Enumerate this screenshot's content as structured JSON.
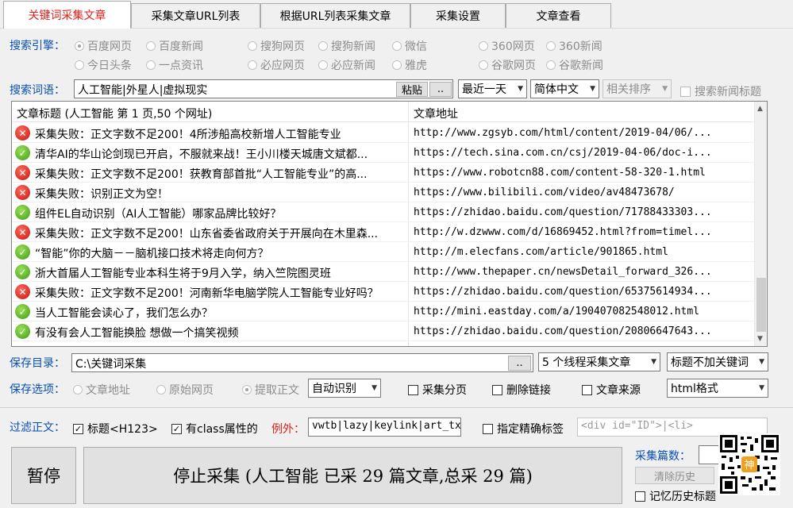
{
  "tabs": [
    "关键词采集文章",
    "采集文章URL列表",
    "根据URL列表采集文章",
    "采集设置",
    "文章查看"
  ],
  "engine": {
    "label": "搜索引擎：",
    "options": [
      "百度网页",
      "百度新闻",
      "搜狗网页",
      "搜狗新闻",
      "微信",
      "360网页",
      "360新闻",
      "今日头条",
      "一点资讯",
      "必应网页",
      "必应新闻",
      "雅虎",
      "谷歌网页",
      "谷歌新闻"
    ]
  },
  "keywords": {
    "label": "搜索词语：",
    "value": "人工智能|外星人|虚拟现实",
    "paste_label": "粘贴",
    "more_label": "..",
    "time_select": "最近一天",
    "lang_select": "简体中文",
    "sort_select": "相关排序",
    "news_title_label": "搜索新闻标题"
  },
  "table": {
    "col_title": "文章标题 (人工智能 第 1 页,50 个网址)",
    "col_url": "文章地址",
    "rows": [
      {
        "status": "fail",
        "title": "采集失败：正文字数不足200！4所涉船高校新增人工智能专业",
        "url": "http://www.zgsyb.com/html/content/2019-04/06/..."
      },
      {
        "status": "ok",
        "title": "清华AI的华山论剑现已开启，不服就来战！王小川楼天城唐文斌都...",
        "url": "https://tech.sina.com.cn/csj/2019-04-06/doc-i..."
      },
      {
        "status": "fail",
        "title": "采集失败：正文字数不足200！获教育部首批“人工智能专业”的高...",
        "url": "https://www.robotcn88.com/content-58-320-1.html"
      },
      {
        "status": "fail",
        "title": "采集失败：识别正文为空！",
        "url": "https://www.bilibili.com/video/av48473678/"
      },
      {
        "status": "ok",
        "title": "组件EL自动识别（AI人工智能）哪家品牌比较好？",
        "url": "https://zhidao.baidu.com/question/71788433303..."
      },
      {
        "status": "fail",
        "title": "采集失败：正文字数不足200！山东省委省政府关于开展向在木里森...",
        "url": "http://w.dzwww.com/d/16869452.html?from=timel..."
      },
      {
        "status": "ok",
        "title": "“智能”你的大脑－－脑机接口技术将走向何方？",
        "url": "http://m.elecfans.com/article/901865.html"
      },
      {
        "status": "ok",
        "title": "浙大首届人工智能专业本科生将于9月入学，纳入竺院图灵班",
        "url": "http://www.thepaper.cn/newsDetail_forward_326..."
      },
      {
        "status": "fail",
        "title": "采集失败：正文字数不足200！河南新华电脑学院人工智能专业好吗？",
        "url": "https://zhidao.baidu.com/question/65375614934..."
      },
      {
        "status": "ok",
        "title": "当人工智能会读心了，我们怎么办？",
        "url": "http://mini.eastday.com/a/190407082548012.html"
      },
      {
        "status": "ok",
        "title": "有没有会人工智能换脸 想做一个搞笑视频",
        "url": "https://zhidao.baidu.com/question/20806647643..."
      }
    ]
  },
  "save": {
    "dir_label": "保存目录：",
    "dir_value": "C:\\关键词采集",
    "dir_btn": "..",
    "threads": "5 个线程采集文章",
    "title_kw": "标题不加关键词",
    "opt_label": "保存选项：",
    "radios": [
      "文章地址",
      "原始网页",
      "提取正文"
    ],
    "extract_mode": "自动识别",
    "checks": [
      "采集分页",
      "删除链接",
      "文章来源"
    ],
    "format": "html格式"
  },
  "filter": {
    "label": "过滤正文：",
    "title_check": "标题<H123>",
    "class_check": "有class属性的",
    "except_label": "例外：",
    "except_value": "vwtb|lazy|keylink|art_tx",
    "precise_label": "指定精确标签",
    "tag_placeholder": "<div id=\"ID\">|<li>"
  },
  "bottom": {
    "pause_label": "暂停",
    "stop_label": "停止采集 (人工智能 已采 29 篇文章,总采 29 篇)",
    "count_label": "采集篇数：",
    "clear_history": "清除历史",
    "remember_history": "记忆历史标题"
  }
}
